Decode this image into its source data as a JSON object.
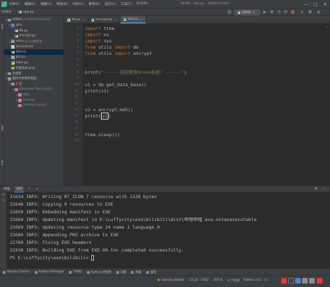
{
  "window": {
    "menus": [
      "文件(F)",
      "编辑(E)",
      "视图(V)",
      "导航(N)",
      "代码(C)",
      "重构(R)",
      "运行(U)",
      "工具(T)",
      "VCS(S)"
    ],
    "title": "bilibili - app.py - Administrator",
    "minimize": "—",
    "maximize": "□",
    "close": "✕"
  },
  "navbar": {
    "crumbs": [
      "bilibili",
      "app.py"
    ],
    "run_config": "DEMO"
  },
  "project": {
    "strip_label_project": "项目",
    "strip_label_structure": "结构",
    "strip_label_bookmarks": "书签",
    "rows": [
      {
        "label": "bilibili",
        "suffix": "E:\\Luffycity\\exe\\bili",
        "icon": "folder",
        "depth": 0,
        "arrow": "▾"
      },
      {
        "label": "utils",
        "icon": "folder-blue",
        "depth": 1,
        "arrow": "▾"
      },
      {
        "label": "db.py",
        "icon": "python-file-icon",
        "depth": 2,
        "arrow": ""
      },
      {
        "label": "encrypt.py",
        "icon": "python-file-icon",
        "depth": 2,
        "arrow": ""
      },
      {
        "label": "venv",
        "suffix": "library根目录",
        "icon": "folder",
        "depth": 1,
        "arrow": "▸"
      },
      {
        "label": "account.txt",
        "icon": "text-file-icon",
        "depth": 1,
        "arrow": ""
      },
      {
        "label": "app.py",
        "icon": "python-file-icon",
        "depth": 1,
        "arrow": "",
        "selected": true
      },
      {
        "label": "bili.ico",
        "icon": "ico-file-icon",
        "depth": 1,
        "arrow": ""
      },
      {
        "label": "main.py",
        "icon": "python-file-icon",
        "depth": 1,
        "arrow": ""
      },
      {
        "label": "外面会员.png",
        "icon": "png-file-icon",
        "depth": 1,
        "arrow": ""
      },
      {
        "label": "外部库",
        "icon": "library-icon",
        "depth": 0,
        "arrow": "▸"
      },
      {
        "label": "临时文件和控制台",
        "icon": "library-icon",
        "depth": 0,
        "arrow": "▾"
      },
      {
        "label": "扩展",
        "icon": "folder",
        "depth": 1,
        "arrow": "▾",
        "tone": "red"
      },
      {
        "label": "Database Tools and S",
        "icon": "folder-pink",
        "depth": 2,
        "arrow": "▾",
        "tone": "grey"
      },
      {
        "label": "data",
        "icon": "folder-pink",
        "depth": 3,
        "arrow": "▸",
        "tone": "grey"
      },
      {
        "label": "schema",
        "icon": "folder-pink",
        "depth": 3,
        "arrow": "▸",
        "tone": "grey"
      },
      {
        "label": "schema.layouts",
        "icon": "folder-pink",
        "depth": 3,
        "arrow": "",
        "tone": "grey"
      }
    ]
  },
  "tabs": [
    {
      "label": "db.py",
      "active": false
    },
    {
      "label": "encrypt.py",
      "active": false
    },
    {
      "label": "app.py",
      "active": true
    }
  ],
  "editor": {
    "line_numbers": [
      "1",
      "2",
      "3",
      "4",
      "5",
      "6",
      "7",
      "8",
      "9",
      "10",
      "11",
      "12",
      "13",
      "14",
      "15",
      "16",
      "17",
      "18",
      "19"
    ],
    "lines": [
      [
        {
          "t": "import",
          "c": "kw"
        },
        {
          "t": " time",
          "c": ""
        }
      ],
      [
        {
          "t": "import",
          "c": "kw"
        },
        {
          "t": " os",
          "c": ""
        }
      ],
      [
        {
          "t": "import",
          "c": "kw"
        },
        {
          "t": " sys",
          "c": ""
        }
      ],
      [
        {
          "t": "from",
          "c": "kw"
        },
        {
          "t": " utils ",
          "c": ""
        },
        {
          "t": "import",
          "c": "kw"
        },
        {
          "t": " db",
          "c": ""
        }
      ],
      [
        {
          "t": "from",
          "c": "kw"
        },
        {
          "t": " utils ",
          "c": ""
        },
        {
          "t": "import",
          "c": "kw"
        },
        {
          "t": " encrypt",
          "c": ""
        }
      ],
      [],
      [],
      [
        {
          "t": "print(",
          "c": ""
        },
        {
          "t": "\"------欢迎使用dream系统! ------\"",
          "c": "str"
        },
        {
          "t": ")",
          "c": ""
        }
      ],
      [],
      [
        {
          "t": "v1 = db.get_data_base()",
          "c": ""
        }
      ],
      [
        {
          "t": "print(v1)",
          "c": ""
        }
      ],
      [],
      [],
      [
        {
          "t": "v2 = encrypt.md5()",
          "c": ""
        }
      ],
      [
        {
          "t": "print(",
          "c": ""
        },
        {
          "t": "v2",
          "c": "caret"
        },
        {
          "t": ")",
          "c": ""
        }
      ],
      [],
      [],
      [
        {
          "t": "time.sleep(",
          "c": ""
        },
        {
          "t": "5",
          "c": "num"
        },
        {
          "t": ")",
          "c": ""
        }
      ],
      []
    ],
    "inspection_mark": "✓"
  },
  "terminal": {
    "tabs": [
      "终端:",
      "本地",
      "+",
      "∨"
    ],
    "lines": [
      "21634 INFO: Writing RT_ICON 7 resource with 1128 bytes",
      "21648 INFO: Copying 0 resources to EXE",
      "21650 INFO: Embedding manifest in EXE",
      "21660 INFO: Updating manifest in E:\\Luffycity\\exe\\bilibili\\dist\\哔哩哔哩.exe.notanexecutable",
      "21669 INFO: Updating resource type 24 name 1 language 0",
      "21680 INFO: Appending PKG archive to EXE",
      "21760 INFO: Fixing EXE headers",
      "21938 INFO: Building EXE from EXE-00.toc completed successfully.",
      "PS E:\\Luffycity\\exe\\bilibili> "
    ]
  },
  "toolwindows": [
    "Version Control",
    "Python Packages",
    "TODO",
    "Python 控制台",
    "问题",
    "终端",
    "服务"
  ],
  "status": {
    "plugin": "tabnine Starter",
    "position": "13:10",
    "line_sep": "CRLF",
    "encoding": "UTF-8",
    "indent": "4 个空格",
    "interpreter": "Python 3.11",
    "brand_color": "#4a88c7"
  }
}
